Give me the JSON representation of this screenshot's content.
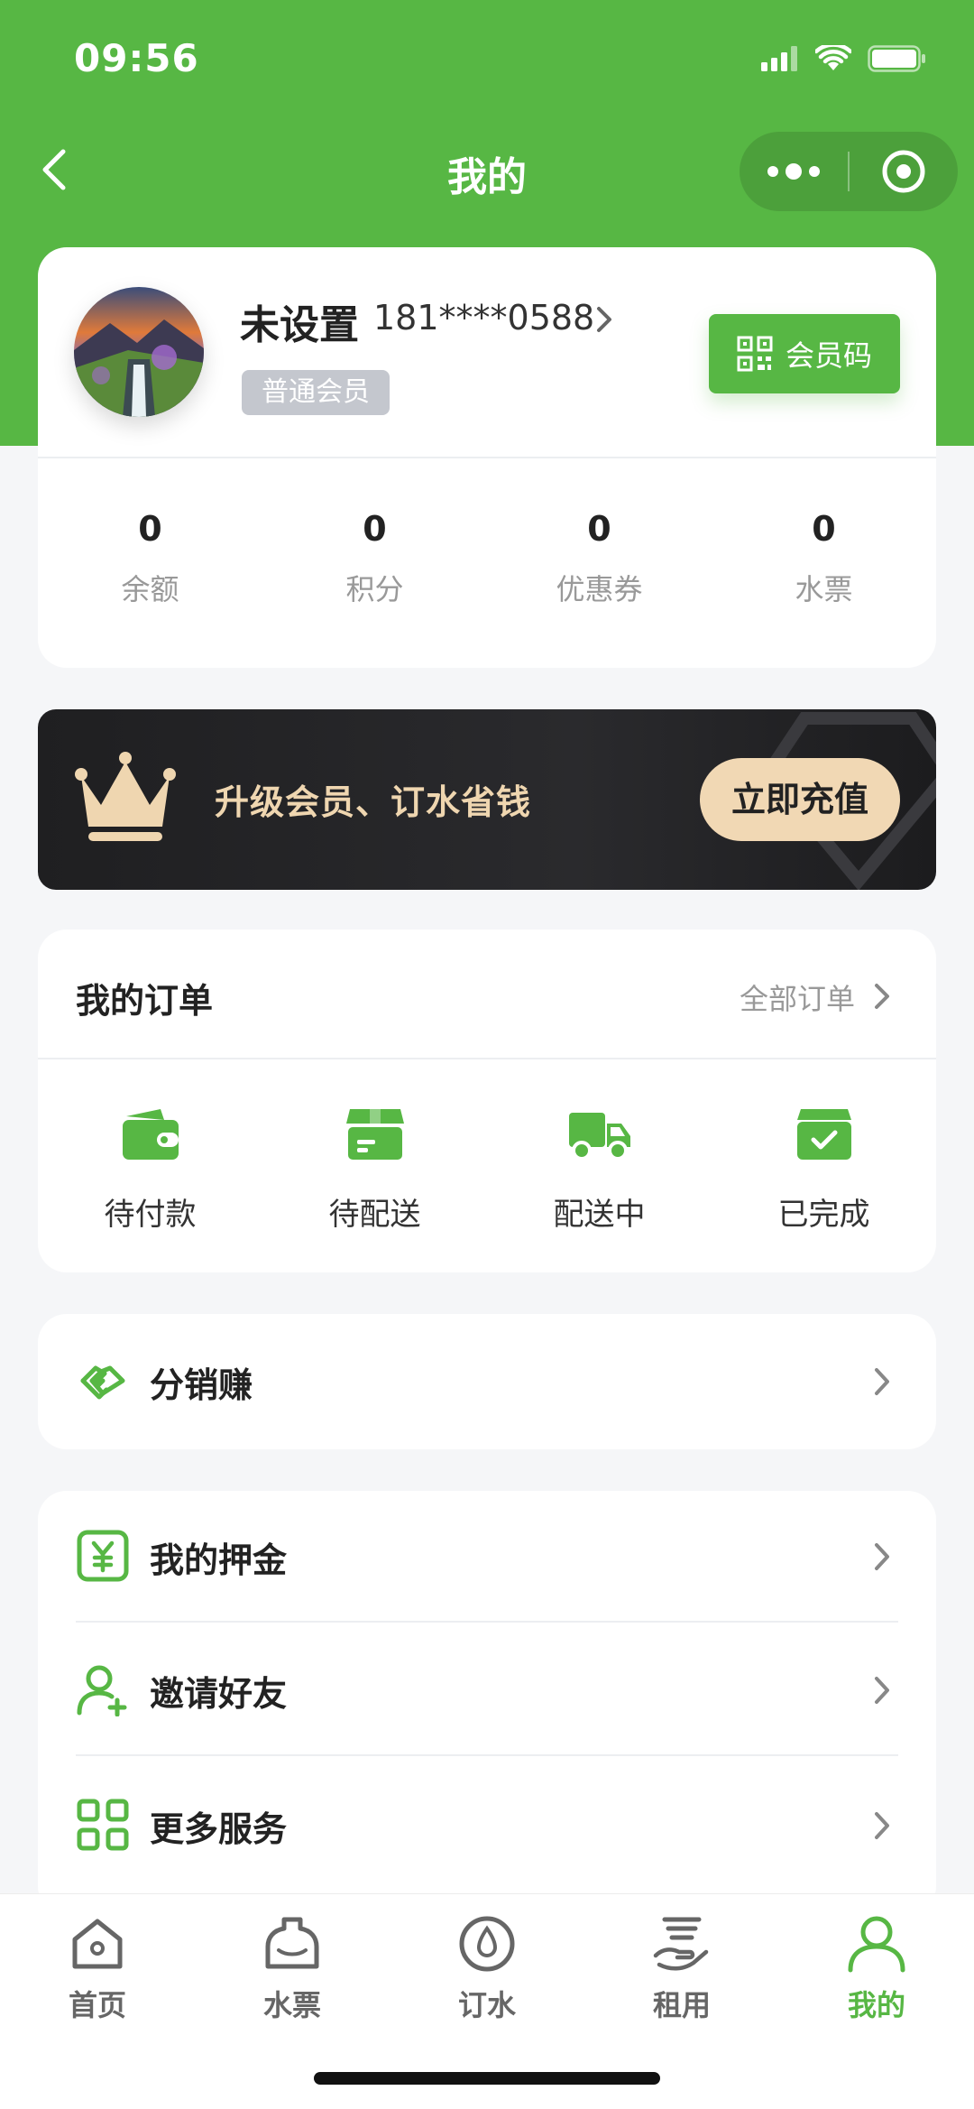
{
  "status_bar": {
    "time": "09:56"
  },
  "nav": {
    "title": "我的"
  },
  "profile": {
    "name": "未设置",
    "phone": "181****0588",
    "member_level": "普通会员",
    "qr_button": "会员码"
  },
  "stats": [
    {
      "value": "0",
      "label": "余额"
    },
    {
      "value": "0",
      "label": "积分"
    },
    {
      "value": "0",
      "label": "优惠券"
    },
    {
      "value": "0",
      "label": "水票"
    }
  ],
  "vip_banner": {
    "text": "升级会员、订水省钱",
    "button": "立即充值"
  },
  "orders": {
    "title": "我的订单",
    "all_link": "全部订单",
    "items": [
      {
        "label": "待付款",
        "icon": "wallet-icon"
      },
      {
        "label": "待配送",
        "icon": "package-icon"
      },
      {
        "label": "配送中",
        "icon": "truck-icon"
      },
      {
        "label": "已完成",
        "icon": "box-check-icon"
      }
    ]
  },
  "menu_distribution": {
    "label": "分销赚",
    "icon": "handshake-icon"
  },
  "menu_list": [
    {
      "label": "我的押金",
      "icon": "yuan-icon"
    },
    {
      "label": "邀请好友",
      "icon": "add-user-icon"
    },
    {
      "label": "更多服务",
      "icon": "grid-icon"
    }
  ],
  "tabbar": {
    "active_index": 4,
    "accent_color": "#57b744",
    "items": [
      {
        "label": "首页",
        "icon": "home-icon"
      },
      {
        "label": "水票",
        "icon": "water-bottle-icon"
      },
      {
        "label": "订水",
        "icon": "water-drop-icon"
      },
      {
        "label": "租用",
        "icon": "rent-hand-icon"
      },
      {
        "label": "我的",
        "icon": "user-icon"
      }
    ]
  },
  "colors": {
    "primary": "#57b744",
    "vip_gold": "#f1d8b4",
    "vip_dark": "#1f1f21"
  }
}
